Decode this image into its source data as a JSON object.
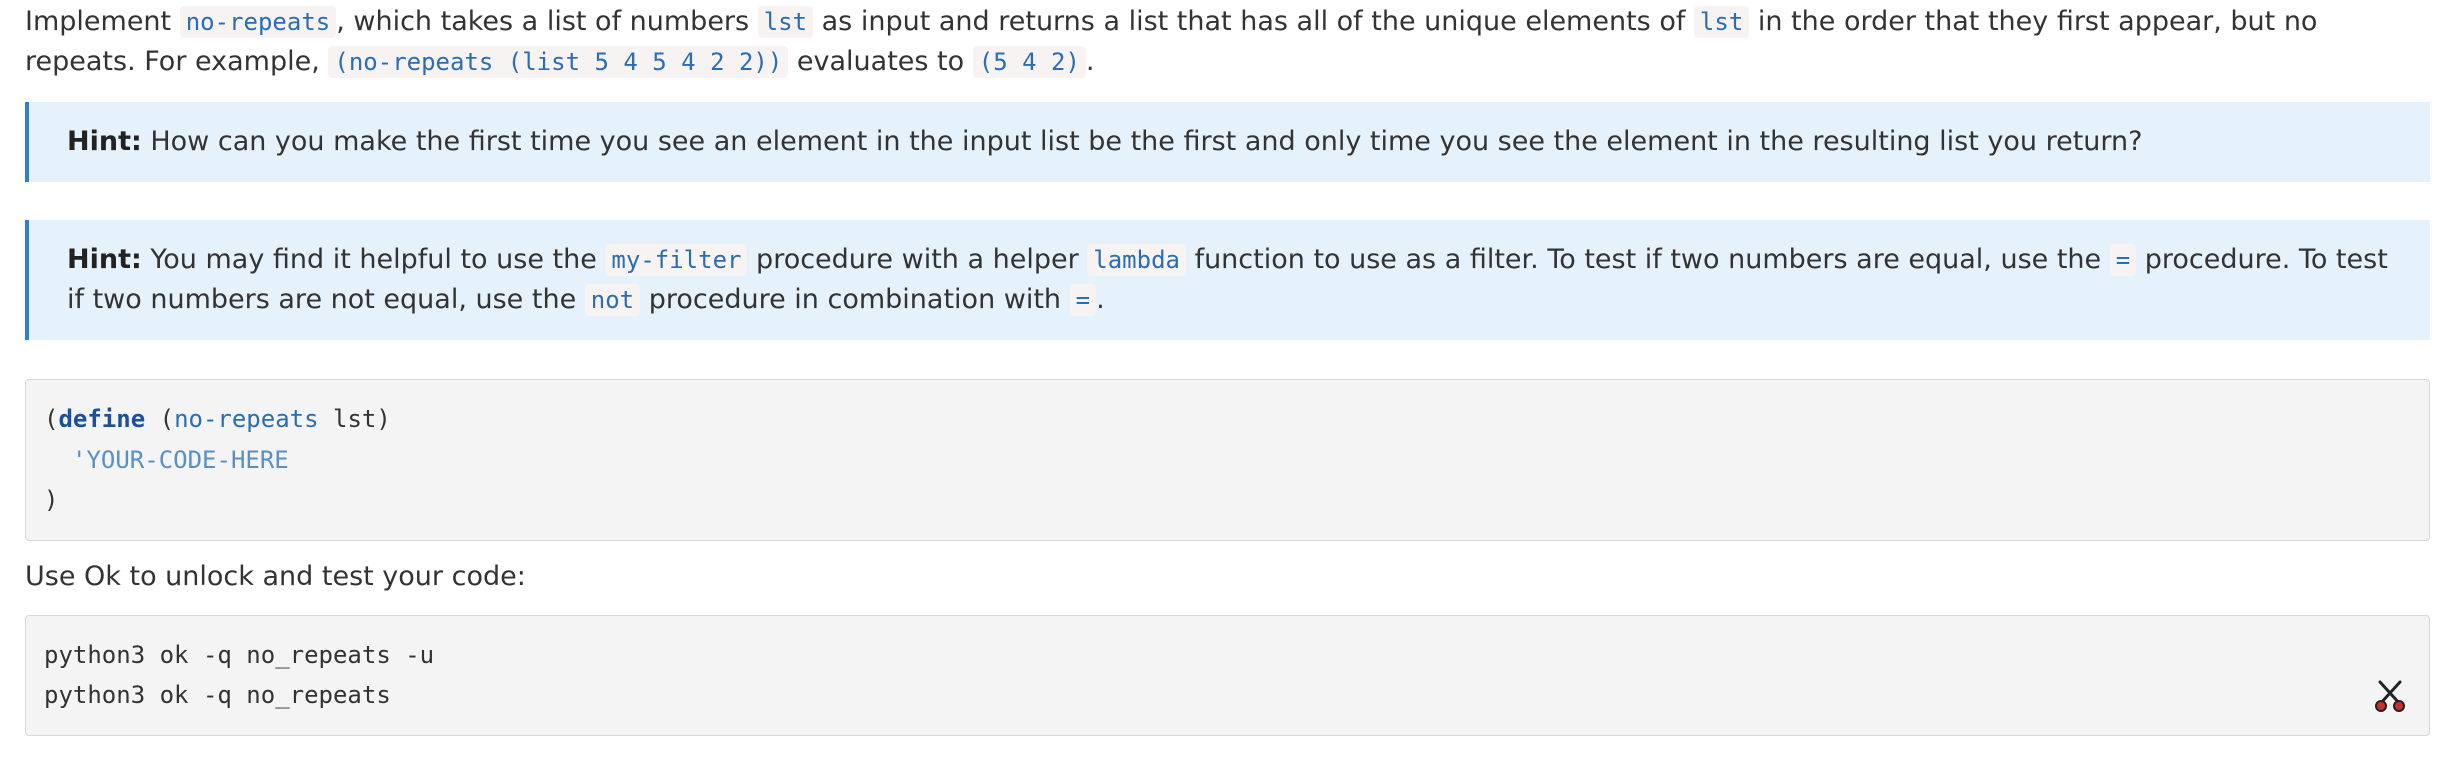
{
  "intro": {
    "t1": "Implement ",
    "c1": "no-repeats",
    "t2": ", which takes a list of numbers ",
    "c2": "lst",
    "t3": " as input and returns a list that has all of the unique elements of ",
    "c3": "lst",
    "t4": " in the order that they first appear, but no repeats. For example, ",
    "c4": "(no-repeats (list 5 4 5 4 2 2))",
    "t5": " evaluates to ",
    "c5": "(5 4 2)",
    "t6": "."
  },
  "hint1": {
    "label": "Hint:",
    "text": " How can you make the first time you see an element in the input list be the first and only time you see the element in the resulting list you return?"
  },
  "hint2": {
    "label": "Hint:",
    "t1": " You may find it helpful to use the ",
    "c1": "my-filter",
    "t2": " procedure with a helper ",
    "c2": "lambda",
    "t3": " function to use as a filter. To test if two numbers are equal, use the ",
    "c3": "=",
    "t4": " procedure. To test if two numbers are not equal, use the ",
    "c4": "not",
    "t5": " procedure in combination with ",
    "c5": "=",
    "t6": "."
  },
  "code": {
    "open": "(",
    "kw": "define",
    "sp1": " (",
    "fn": "no-repeats",
    "args": " lst)",
    "placeholder": "'YOUR-CODE-HERE",
    "close": ")"
  },
  "instructions": "Use Ok to unlock and test your code:",
  "commands": [
    "python3 ok -q no_repeats -u",
    "python3 ok -q no_repeats"
  ],
  "copy_icon": "scissors-icon"
}
